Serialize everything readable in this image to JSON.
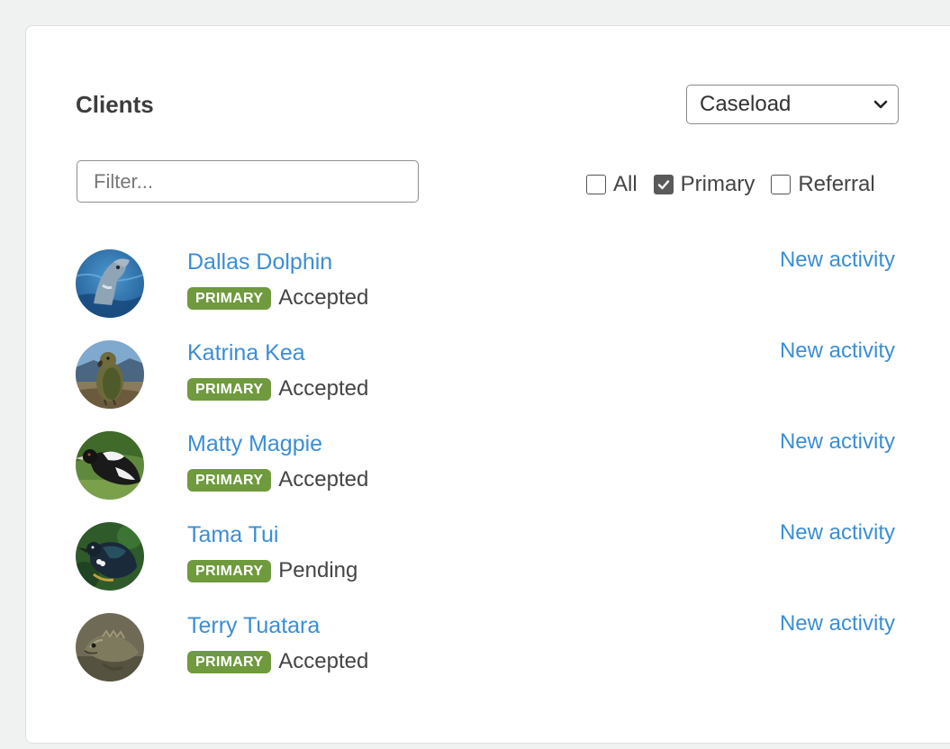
{
  "panel": {
    "title": "Clients",
    "view_select": {
      "selected": "Caseload"
    },
    "filter": {
      "placeholder": "Filter...",
      "value": ""
    },
    "checkboxes": [
      {
        "label": "All",
        "checked": false
      },
      {
        "label": "Primary",
        "checked": true
      },
      {
        "label": "Referral",
        "checked": false
      }
    ]
  },
  "clients": [
    {
      "name": "Dallas Dolphin",
      "badge": "PRIMARY",
      "status": "Accepted",
      "action": "New activity",
      "avatar": "dolphin-photo"
    },
    {
      "name": "Katrina Kea",
      "badge": "PRIMARY",
      "status": "Accepted",
      "action": "New activity",
      "avatar": "kea-photo"
    },
    {
      "name": "Matty Magpie",
      "badge": "PRIMARY",
      "status": "Accepted",
      "action": "New activity",
      "avatar": "magpie-photo"
    },
    {
      "name": "Tama Tui",
      "badge": "PRIMARY",
      "status": "Pending",
      "action": "New activity",
      "avatar": "tui-photo"
    },
    {
      "name": "Terry Tuatara",
      "badge": "PRIMARY",
      "status": "Accepted",
      "action": "New activity",
      "avatar": "tuatara-photo"
    }
  ],
  "colors": {
    "link": "#3b8ed4",
    "badge": "#6f9a3d",
    "page_bg": "#f0f1f1"
  }
}
